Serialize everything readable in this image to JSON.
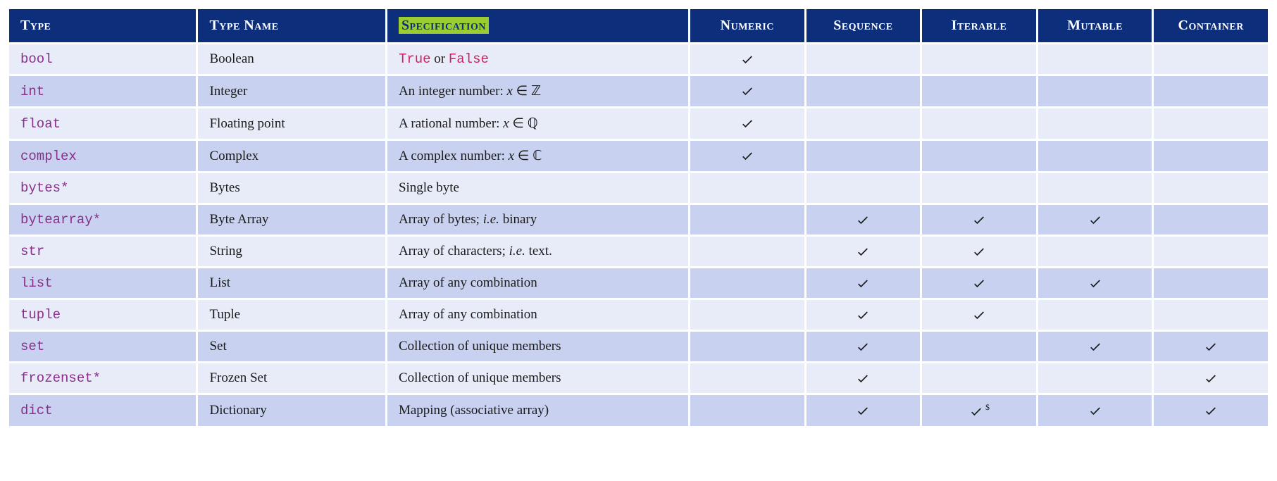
{
  "headers": {
    "type": "Type",
    "type_name": "Type Name",
    "specification": "Specification",
    "numeric": "Numeric",
    "sequence": "Sequence",
    "iterable": "Iterable",
    "mutable": "Mutable",
    "container": "Container"
  },
  "rows": [
    {
      "type": "bool",
      "star": false,
      "type_name": "Boolean",
      "spec_kind": "truefalse",
      "spec_pre": "",
      "spec_kw1": "True",
      "spec_mid": " or ",
      "spec_kw2": "False",
      "numeric": true,
      "sequence": false,
      "iterable": false,
      "mutable": false,
      "container": false
    },
    {
      "type": "int",
      "star": false,
      "type_name": "Integer",
      "spec_kind": "math",
      "spec_pre": "An integer number: ",
      "spec_math_var": "x",
      "spec_math_rel": " ∈ ",
      "spec_math_set": "ℤ",
      "numeric": true,
      "sequence": false,
      "iterable": false,
      "mutable": false,
      "container": false
    },
    {
      "type": "float",
      "star": false,
      "type_name": "Floating point",
      "spec_kind": "math",
      "spec_pre": "A rational number: ",
      "spec_math_var": "x",
      "spec_math_rel": " ∈ ",
      "spec_math_set": "ℚ",
      "numeric": true,
      "sequence": false,
      "iterable": false,
      "mutable": false,
      "container": false
    },
    {
      "type": "complex",
      "star": false,
      "type_name": "Complex",
      "spec_kind": "math",
      "spec_pre": "A complex number: ",
      "spec_math_var": "x",
      "spec_math_rel": " ∈ ",
      "spec_math_set": "ℂ",
      "numeric": true,
      "sequence": false,
      "iterable": false,
      "mutable": false,
      "container": false
    },
    {
      "type": "bytes",
      "star": true,
      "type_name": "Bytes",
      "spec_kind": "plain",
      "spec_text": "Single byte",
      "numeric": false,
      "sequence": false,
      "iterable": false,
      "mutable": false,
      "container": false
    },
    {
      "type": "bytearray",
      "star": true,
      "type_name": "Byte Array",
      "spec_kind": "ie",
      "spec_pre": "Array of bytes; ",
      "spec_ie": "i.e.",
      "spec_post": " binary",
      "numeric": false,
      "sequence": true,
      "iterable": true,
      "mutable": true,
      "container": false
    },
    {
      "type": "str",
      "star": false,
      "type_name": "String",
      "spec_kind": "ie",
      "spec_pre": "Array of characters; ",
      "spec_ie": "i.e.",
      "spec_post": " text.",
      "numeric": false,
      "sequence": true,
      "iterable": true,
      "mutable": false,
      "container": false
    },
    {
      "type": "list",
      "star": false,
      "type_name": "List",
      "spec_kind": "plain",
      "spec_text": "Array of any combination",
      "numeric": false,
      "sequence": true,
      "iterable": true,
      "mutable": true,
      "container": false
    },
    {
      "type": "tuple",
      "star": false,
      "type_name": "Tuple",
      "spec_kind": "plain",
      "spec_text": "Array of any combination",
      "numeric": false,
      "sequence": true,
      "iterable": true,
      "mutable": false,
      "container": false
    },
    {
      "type": "set",
      "star": false,
      "type_name": "Set",
      "spec_kind": "plain",
      "spec_text": "Collection of unique members",
      "numeric": false,
      "sequence": true,
      "iterable": false,
      "mutable": true,
      "container": true
    },
    {
      "type": "frozenset",
      "star": true,
      "type_name": "Frozen Set",
      "spec_kind": "plain",
      "spec_text": "Collection of unique members",
      "numeric": false,
      "sequence": true,
      "iterable": false,
      "mutable": false,
      "container": true
    },
    {
      "type": "dict",
      "star": false,
      "type_name": "Dictionary",
      "spec_kind": "plain",
      "spec_text": "Mapping (associative array)",
      "numeric": false,
      "sequence": true,
      "iterable": true,
      "iterable_note": "$",
      "mutable": true,
      "container": true
    }
  ],
  "star_glyph": "*",
  "chart_data": {
    "type": "table",
    "title": "Python Built-in Types",
    "columns": [
      "Type",
      "Type Name",
      "Specification",
      "Numeric",
      "Sequence",
      "Iterable",
      "Mutable",
      "Container"
    ],
    "rows": [
      [
        "bool",
        "Boolean",
        "True or False",
        true,
        false,
        false,
        false,
        false
      ],
      [
        "int",
        "Integer",
        "An integer number: x ∈ ℤ",
        true,
        false,
        false,
        false,
        false
      ],
      [
        "float",
        "Floating point",
        "A rational number: x ∈ ℚ",
        true,
        false,
        false,
        false,
        false
      ],
      [
        "complex",
        "Complex",
        "A complex number: x ∈ ℂ",
        true,
        false,
        false,
        false,
        false
      ],
      [
        "bytes*",
        "Bytes",
        "Single byte",
        false,
        false,
        false,
        false,
        false
      ],
      [
        "bytearray*",
        "Byte Array",
        "Array of bytes; i.e. binary",
        false,
        true,
        true,
        true,
        false
      ],
      [
        "str",
        "String",
        "Array of characters; i.e. text.",
        false,
        true,
        true,
        false,
        false
      ],
      [
        "list",
        "List",
        "Array of any combination",
        false,
        true,
        true,
        true,
        false
      ],
      [
        "tuple",
        "Tuple",
        "Array of any combination",
        false,
        true,
        true,
        false,
        false
      ],
      [
        "set",
        "Set",
        "Collection of unique members",
        false,
        true,
        false,
        true,
        true
      ],
      [
        "frozenset*",
        "Frozen Set",
        "Collection of unique members",
        false,
        true,
        false,
        false,
        true
      ],
      [
        "dict",
        "Dictionary",
        "Mapping (associative array)",
        false,
        true,
        "true ($)",
        true,
        true
      ]
    ]
  }
}
